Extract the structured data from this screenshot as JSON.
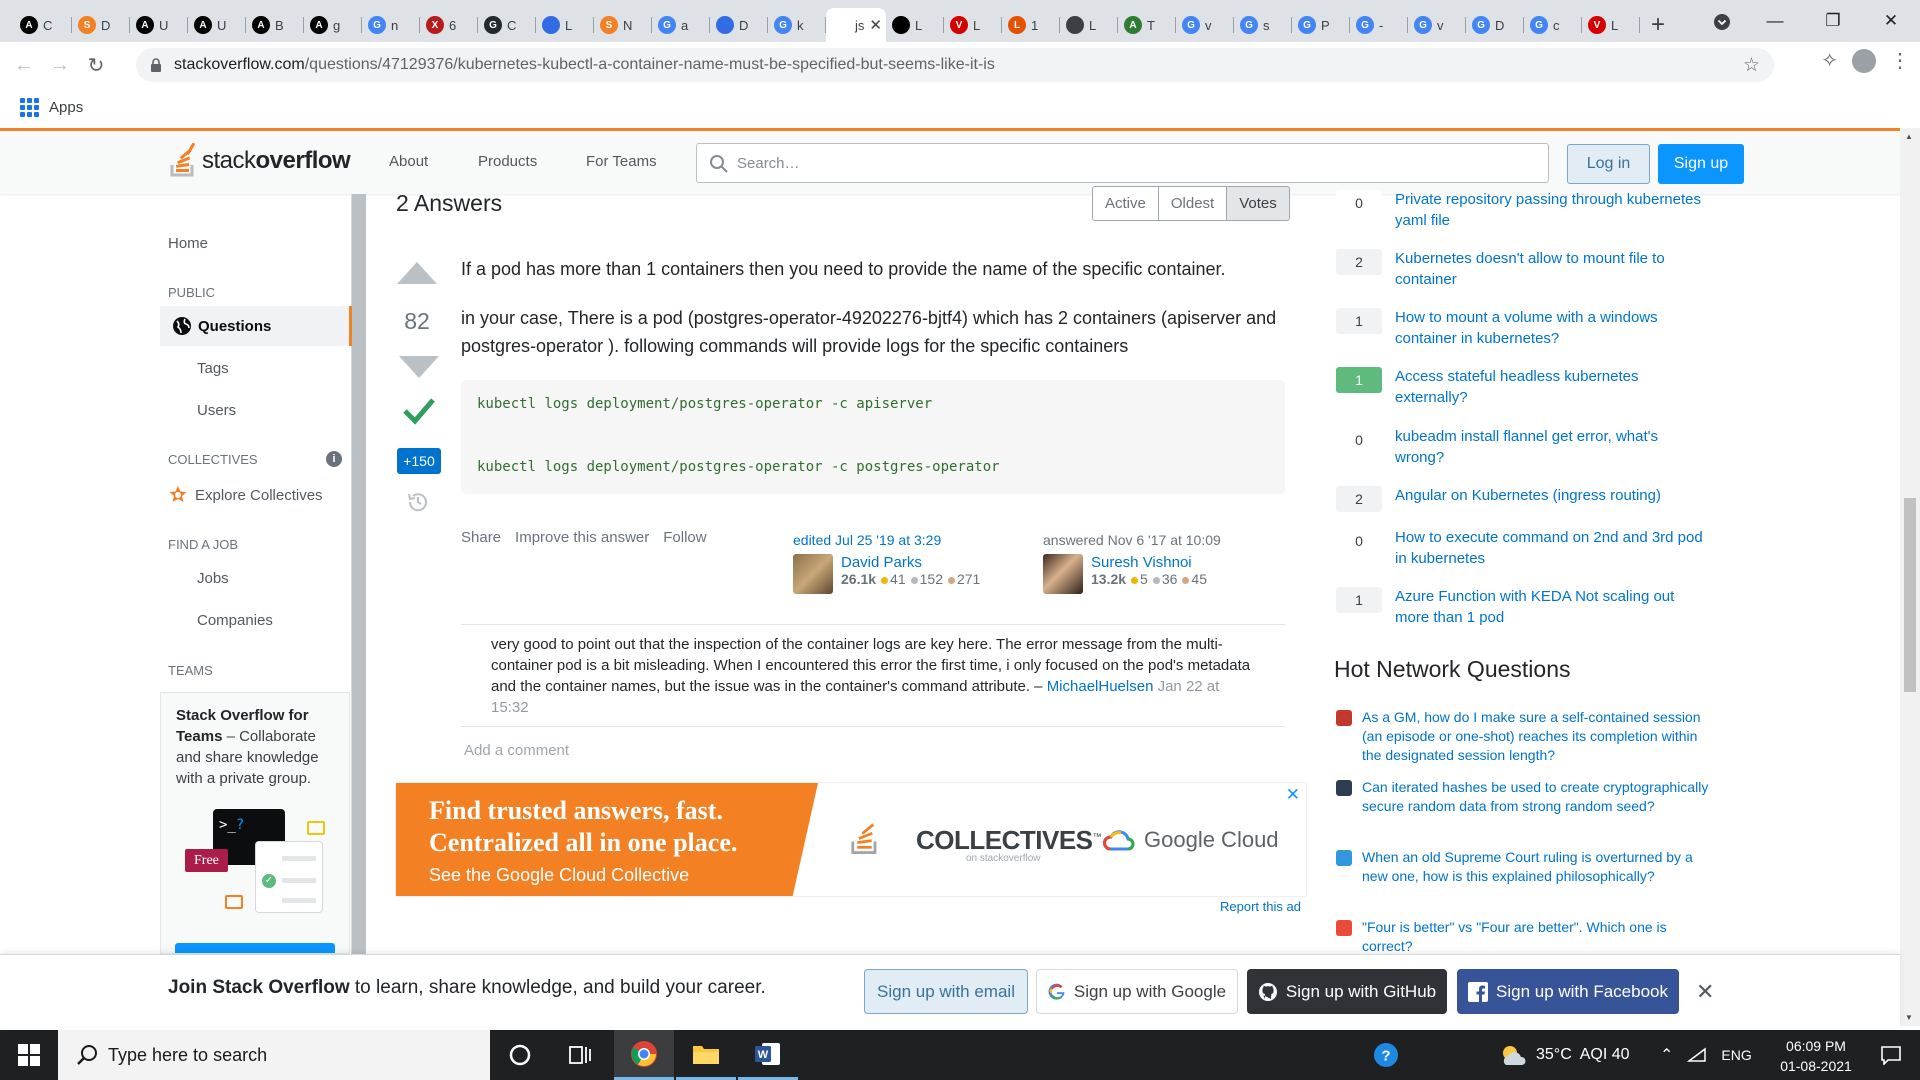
{
  "browser": {
    "tabs": [
      {
        "letter": "C",
        "color": "#000000",
        "icon": "A"
      },
      {
        "letter": "D",
        "color": "#f48024",
        "icon": "so"
      },
      {
        "letter": "U",
        "color": "#000000",
        "icon": "A"
      },
      {
        "letter": "U",
        "color": "#000000",
        "icon": "A"
      },
      {
        "letter": "B",
        "color": "#000000",
        "icon": "A"
      },
      {
        "letter": "g",
        "color": "#000000",
        "icon": "A"
      },
      {
        "letter": "n",
        "color": "#4285f4",
        "icon": "G"
      },
      {
        "letter": "6",
        "color": "#b71c1c",
        "icon": "x"
      },
      {
        "letter": "C",
        "color": "#24292e",
        "icon": "gh"
      },
      {
        "letter": "L",
        "color": "#326ce5",
        "icon": "k8s"
      },
      {
        "letter": "N",
        "color": "#f48024",
        "icon": "so"
      },
      {
        "letter": "a",
        "color": "#4285f4",
        "icon": "G"
      },
      {
        "letter": "D",
        "color": "#326ce5",
        "icon": "k8s"
      },
      {
        "letter": "k",
        "color": "#4285f4",
        "icon": "G"
      },
      {
        "letter": "js",
        "color": "#ffffff",
        "icon": "js",
        "active": true
      },
      {
        "letter": "L",
        "color": "#000000",
        "icon": "hex"
      },
      {
        "letter": "L",
        "color": "#d50000",
        "icon": "V"
      },
      {
        "letter": "1",
        "color": "#e65100",
        "icon": "Li"
      },
      {
        "letter": "L",
        "color": "#3c4043",
        "icon": "globe"
      },
      {
        "letter": "T",
        "color": "#2e7d32",
        "icon": "ab"
      },
      {
        "letter": "v",
        "color": "#4285f4",
        "icon": "G"
      },
      {
        "letter": "s",
        "color": "#4285f4",
        "icon": "G"
      },
      {
        "letter": "P",
        "color": "#4285f4",
        "icon": "G"
      },
      {
        "letter": "-",
        "color": "#4285f4",
        "icon": "G"
      },
      {
        "letter": "v",
        "color": "#4285f4",
        "icon": "G"
      },
      {
        "letter": "D",
        "color": "#4285f4",
        "icon": "G"
      },
      {
        "letter": "c",
        "color": "#4285f4",
        "icon": "G"
      },
      {
        "letter": "L",
        "color": "#d50000",
        "icon": "V"
      }
    ],
    "url_host": "stackoverflow.com",
    "url_path": "/questions/47129376/kubernetes-kubectl-a-container-name-must-be-specified-but-seems-like-it-is",
    "bookmark_apps": "Apps"
  },
  "header": {
    "logo_light": "stack",
    "logo_bold": "overflow",
    "nav": [
      "About",
      "Products",
      "For Teams"
    ],
    "search_placeholder": "Search…",
    "login": "Log in",
    "signup": "Sign up"
  },
  "sidebar": {
    "home": "Home",
    "public": "PUBLIC",
    "questions": "Questions",
    "tags": "Tags",
    "users": "Users",
    "collectives": "COLLECTIVES",
    "explore_collectives": "Explore Collectives",
    "find_a_job": "FIND A JOB",
    "jobs": "Jobs",
    "companies": "Companies",
    "teams": "TEAMS",
    "teams_title": "Stack Overflow for Teams",
    "teams_desc": " – Collaborate and share knowledge with a private group.",
    "free_badge": "Free"
  },
  "answers": {
    "heading": "2 Answers",
    "sort": [
      "Active",
      "Oldest",
      "Votes"
    ],
    "vote_count": "82",
    "bounty": "+150",
    "p1": "If a pod has more than 1 containers then you need to provide the name of the specific container.",
    "p2": "in your case, There is a pod (postgres-operator-49202276-bjtf4) which has 2 containers (apiserver and postgres-operator ). following commands will provide logs for the specific containers",
    "code1": "kubectl logs deployment/postgres-operator -c apiserver",
    "code2": "kubectl logs deployment/postgres-operator -c postgres-operator",
    "menu": [
      "Share",
      "Improve this answer",
      "Follow"
    ],
    "editor": {
      "action": "edited Jul 25 '19 at 3:29",
      "name": "David Parks",
      "rep": "26.1k",
      "gold": "41",
      "silver": "152",
      "bronze": "271"
    },
    "author": {
      "action": "answered Nov 6 '17 at 10:09",
      "name": "Suresh Vishnoi",
      "rep": "13.2k",
      "gold": "5",
      "silver": "36",
      "bronze": "45"
    },
    "comment_text": "very good to point out that the inspection of the container logs are key here. The error message from the multi-container pod is a bit misleading. When I encountered this error the first time, i only focused on the pod's metadata and the container names, but the issue was in the container's command attribute. – ",
    "comment_user": "MichaelHuelsen",
    "comment_date": "Jan 22 at 15:32",
    "add_comment": "Add a comment"
  },
  "ad": {
    "line1": "Find trusted answers, fast.",
    "line2": "Centralized all in one place.",
    "sub": "See the Google Cloud Collective",
    "collectives": "COLLECTIVES",
    "collectives_tm": "™",
    "on_so": "on stackoverflow",
    "google_cloud": "Google Cloud",
    "report": "Report this ad"
  },
  "related": [
    {
      "count": "0",
      "title": "Private repository passing through kubernetes yaml file",
      "kind": "zero"
    },
    {
      "count": "2",
      "title": "Kubernetes doesn't allow to mount file to container",
      "kind": "pos"
    },
    {
      "count": "1",
      "title": "How to mount a volume with a windows container in kubernetes?",
      "kind": "pos"
    },
    {
      "count": "1",
      "title": "Access stateful headless kubernetes externally?",
      "kind": "acc"
    },
    {
      "count": "0",
      "title": "kubeadm install flannel get error, what's wrong?",
      "kind": "zero"
    },
    {
      "count": "2",
      "title": "Angular on Kubernetes (ingress routing)",
      "kind": "pos"
    },
    {
      "count": "0",
      "title": "How to execute command on 2nd and 3rd pod in kubernetes",
      "kind": "zero"
    },
    {
      "count": "1",
      "title": "Azure Function with KEDA Not scaling out more than 1 pod",
      "kind": "pos"
    }
  ],
  "hnq": {
    "title": "Hot Network Questions",
    "items": [
      {
        "title": "As a GM, how do I make sure a self-contained session (an episode or one-shot) reaches its completion within the designated session length?",
        "icon": "rpg",
        "color": "#c0392b"
      },
      {
        "title": "Can iterated hashes be used to create cryptographically secure random data from strong random seed?",
        "icon": "crypto",
        "color": "#2c3e50"
      },
      {
        "title": "When an old Supreme Court ruling is overturned by a new one, how is this explained philosophically?",
        "icon": "law",
        "color": "#3498db"
      },
      {
        "title": "\"Four is better\" vs \"Four are better\". Which one is correct?",
        "icon": "ell",
        "color": "#e74c3c"
      }
    ]
  },
  "join": {
    "bold": "Join Stack Overflow",
    "rest": " to learn, share knowledge, and build your career.",
    "email": "Sign up with email",
    "google": "Sign up with Google",
    "github": "Sign up with GitHub",
    "facebook": "Sign up with Facebook"
  },
  "taskbar": {
    "search_placeholder": "Type here to search",
    "temp": "35°C",
    "aqi": "AQI 40",
    "lang": "ENG",
    "time": "06:09 PM",
    "date": "01-08-2021"
  }
}
